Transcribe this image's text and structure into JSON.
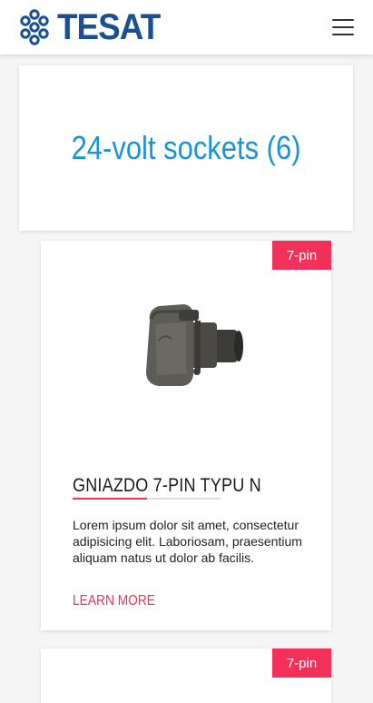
{
  "header": {
    "logo_text": "TESAT",
    "logo_icon": "tesat-dots-logo-icon",
    "menu_icon": "hamburger-menu-icon"
  },
  "main": {
    "title": "24-volt sockets (6)",
    "products": [
      {
        "badge": "7-pin",
        "name": "GNIAZDO 7-PIN TYPU N",
        "description": "Lorem ipsum dolor sit amet, consectetur adipisicing elit. Laboriosam, praesentium aliquam natus ut dolor ab facilis.",
        "link": "LEARN MORE",
        "image_icon": "socket-product-image"
      },
      {
        "badge": "7-pin"
      }
    ]
  },
  "colors": {
    "brand_blue": "#1b4f94",
    "title_blue": "#1a94d6",
    "accent_pink": "#f2305a"
  }
}
